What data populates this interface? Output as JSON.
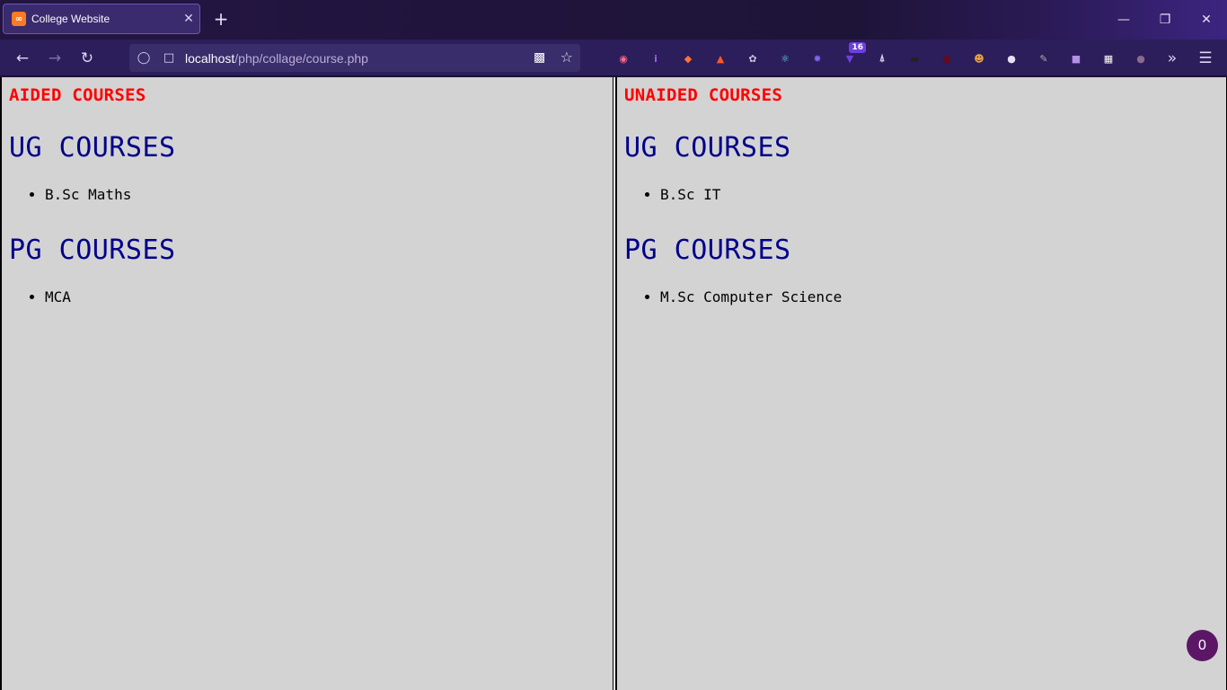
{
  "browser": {
    "tab": {
      "title": "College Website",
      "favicon": "xampp-icon"
    },
    "url": {
      "host": "localhost",
      "path": "/php/collage/course.php"
    },
    "extensions": [
      {
        "name": "pocket-icon",
        "color": "#ff6b8a"
      },
      {
        "name": "info-icon",
        "color": "#9b5cf6"
      },
      {
        "name": "firefox-relay-icon",
        "color": "#ff7139"
      },
      {
        "name": "translate-icon",
        "color": "#ff5722"
      },
      {
        "name": "cookie-icon",
        "color": "#c8c1e0"
      },
      {
        "name": "react-devtools-icon",
        "color": "#61dafb"
      },
      {
        "name": "redux-icon",
        "color": "#7b68ee"
      },
      {
        "name": "vue-devtools-icon",
        "color": "#6d3fe0",
        "badge": "16"
      },
      {
        "name": "git-icon",
        "color": "#d9d4ea"
      },
      {
        "name": "hat-icon",
        "color": "#222222"
      },
      {
        "name": "ublock-icon",
        "color": "#800000"
      },
      {
        "name": "tampermonkey-icon",
        "color": "#e6a23c"
      },
      {
        "name": "privacy-badger-icon",
        "color": "#e6e0f5"
      },
      {
        "name": "color-picker-icon",
        "color": "#aaaaaa"
      },
      {
        "name": "box-icon",
        "color": "#b48fe6"
      },
      {
        "name": "grid-icon",
        "color": "#ffffff"
      },
      {
        "name": "dots-icon",
        "color": "#8a6a8f"
      }
    ]
  },
  "aided": {
    "title": "AIDED COURSES",
    "ug_title": "UG COURSES",
    "ug": [
      "B.Sc Maths"
    ],
    "pg_title": "PG COURSES",
    "pg": [
      "MCA"
    ]
  },
  "unaided": {
    "title": "UNAIDED COURSES",
    "ug_title": "UG COURSES",
    "ug": [
      "B.Sc IT"
    ],
    "pg_title": "PG COURSES",
    "pg": [
      "M.Sc Computer Science"
    ]
  },
  "fab": {
    "label": "0"
  },
  "colors": {
    "section": "#ff0000",
    "group": "#00008b",
    "panel_bg": "#d3d3d3"
  }
}
